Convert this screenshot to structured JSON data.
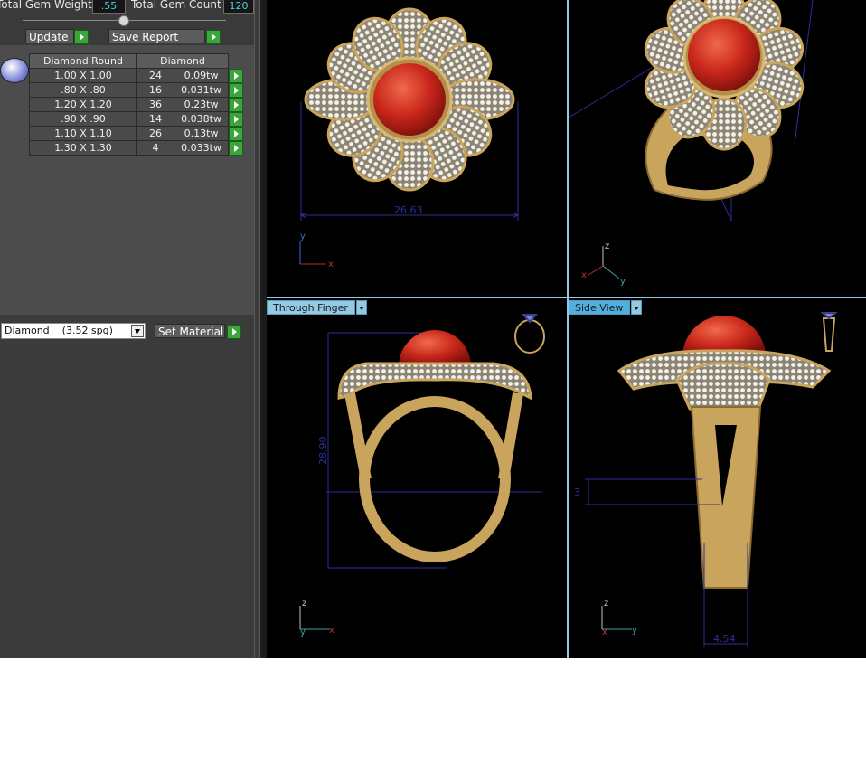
{
  "header": {
    "total_gem_weight_label": "Total Gem Weight",
    "total_gem_weight_value": ".55",
    "total_gem_count_label": "Total Gem Count",
    "total_gem_count_value": "120"
  },
  "actions": {
    "update_label": "Update",
    "save_report_label": "Save Report"
  },
  "gem_table": {
    "columns": [
      "Diamond Round",
      "Diamond"
    ],
    "rows": [
      {
        "size": "1.00 X 1.00",
        "count": "24",
        "weight": "0.09tw"
      },
      {
        "size": ".80 X .80",
        "count": "16",
        "weight": "0.031tw"
      },
      {
        "size": "1.20 X 1.20",
        "count": "36",
        "weight": "0.23tw"
      },
      {
        "size": ".90 X .90",
        "count": "14",
        "weight": "0.038tw"
      },
      {
        "size": "1.10 X 1.10",
        "count": "26",
        "weight": "0.13tw"
      },
      {
        "size": "1.30 X 1.30",
        "count": "4",
        "weight": "0.033tw"
      }
    ]
  },
  "material": {
    "selected": "Diamond    (3.52 spg)",
    "set_material_label": "Set Material"
  },
  "viewports": {
    "top_view": {
      "dimension": "26.63",
      "axis_labels": [
        "y",
        "x"
      ]
    },
    "perspective": {
      "axis_labels": [
        "z",
        "x",
        "y"
      ]
    },
    "through_finger": {
      "tab_label": "Through Finger",
      "dimension": "28.90",
      "axis_labels": [
        "z",
        "y",
        "x"
      ]
    },
    "side_view": {
      "tab_label": "Side View",
      "dimension_shank": "4.54",
      "dimension_small": "3",
      "axis_labels": [
        "z",
        "x",
        "y"
      ]
    }
  },
  "colors": {
    "viewport_border": "#8fc8e8",
    "dimension_line": "#2e2e9c",
    "gold": "#c9a45c",
    "coral_stone": "#c8261b",
    "action_go": "#3aa53a"
  },
  "icons": {
    "go_button": "green-play-arrow",
    "gem_preview": "round-gem-icon",
    "ring_thumbnail": "ring-outline-icon",
    "side_ring_thumbnail": "ring-side-outline-icon"
  }
}
